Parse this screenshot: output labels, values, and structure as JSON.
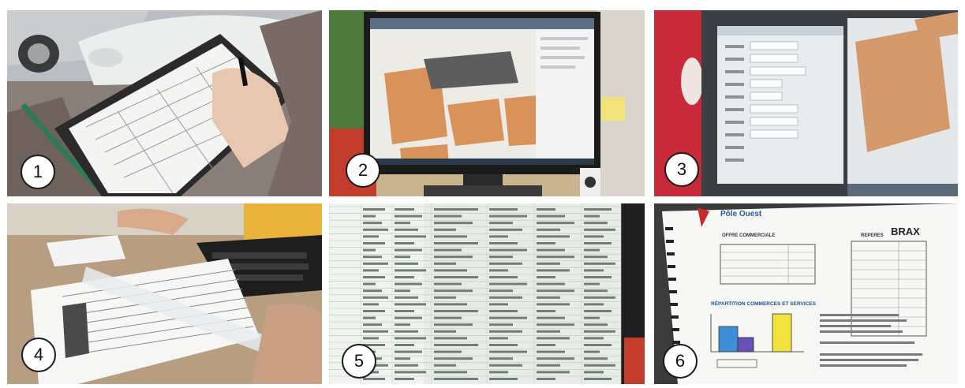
{
  "panels": [
    {
      "id": "1",
      "label": "1",
      "subject": "clipboard survey form"
    },
    {
      "id": "2",
      "label": "2",
      "subject": "monitor with GIS map"
    },
    {
      "id": "3",
      "label": "3",
      "subject": "attribute table window"
    },
    {
      "id": "4",
      "label": "4",
      "subject": "printed sheets and ruler"
    },
    {
      "id": "5",
      "label": "5",
      "subject": "spreadsheet on screen"
    },
    {
      "id": "6",
      "label": "6",
      "subject": "bound report page"
    }
  ],
  "report": {
    "header": "Pôle Ouest",
    "town": "BRAX",
    "section_offer": "OFFRE COMMERCIALE",
    "section_marks": "REPERES",
    "chart_title": "RÉPARTITION COMMERCES ET SERVICES"
  },
  "colors": {
    "background": "#ffffff",
    "badge_border": "#1a1a1a",
    "parcel_orange": "#d9925a",
    "chart_blue": "#3f8fd6",
    "chart_purple": "#6a4fb8",
    "chart_yellow": "#f2e23c"
  }
}
